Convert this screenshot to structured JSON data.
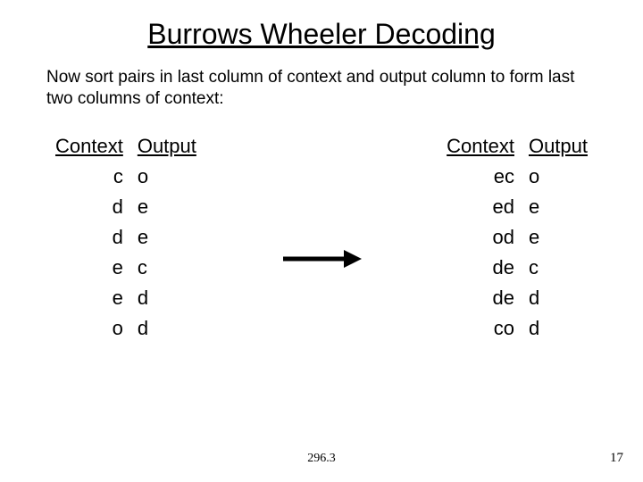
{
  "title": "Burrows Wheeler Decoding",
  "body": "Now sort pairs in last column of context and output column to form last two columns of context:",
  "left": {
    "hdr_ctx": "Context",
    "hdr_out": "Output",
    "rows": [
      {
        "ctx": "c",
        "out": "o"
      },
      {
        "ctx": "d",
        "out": "e"
      },
      {
        "ctx": "d",
        "out": "e"
      },
      {
        "ctx": "e",
        "out": "c"
      },
      {
        "ctx": "e",
        "out": "d"
      },
      {
        "ctx": "o",
        "out": "d"
      }
    ]
  },
  "right": {
    "hdr_ctx": "Context",
    "hdr_out": "Output",
    "rows": [
      {
        "ctx": "ec",
        "out": "o"
      },
      {
        "ctx": "ed",
        "out": "e"
      },
      {
        "ctx": "od",
        "out": "e"
      },
      {
        "ctx": "de",
        "out": "c"
      },
      {
        "ctx": "de",
        "out": "d"
      },
      {
        "ctx": "co",
        "out": "d"
      }
    ]
  },
  "footer_center": "296.3",
  "footer_right": "17"
}
